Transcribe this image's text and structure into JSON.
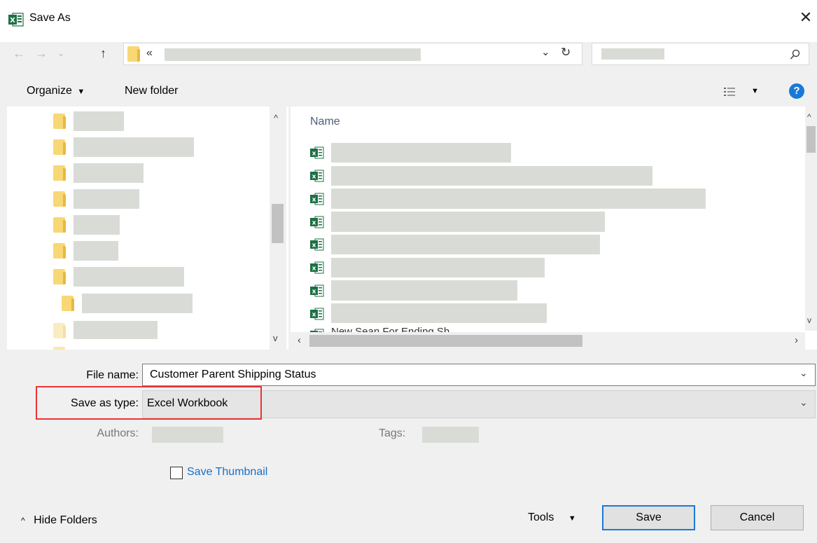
{
  "window": {
    "title": "Save As",
    "close_glyph": "✕",
    "app_icon": "excel-icon"
  },
  "address_bar": {
    "breadcrumb_prefix": "«",
    "dropdown_glyph": "⌄",
    "refresh_glyph": "↻",
    "search_glyph": "⌕"
  },
  "toolbar": {
    "organize_label": "Organize",
    "new_folder_label": "New folder",
    "help_glyph": "?"
  },
  "file_list": {
    "column_name": "Name",
    "partial_item_text": "New Sean For Ending Sh..."
  },
  "form": {
    "file_name_label": "File name:",
    "file_name_value": "Customer Parent Shipping Status",
    "save_as_type_label": "Save as type:",
    "save_as_type_value": "Excel Workbook",
    "authors_label": "Authors:",
    "tags_label": "Tags:",
    "save_thumbnail_label": "Save Thumbnail",
    "save_thumbnail_checked": false
  },
  "footer": {
    "hide_folders_label": "Hide Folders",
    "tools_label": "Tools",
    "save_label": "Save",
    "cancel_label": "Cancel"
  },
  "colors": {
    "accent": "#1a79d6",
    "highlight": "#e33333",
    "excel_green": "#1d7044",
    "folder_yellow": "#f8d775"
  }
}
